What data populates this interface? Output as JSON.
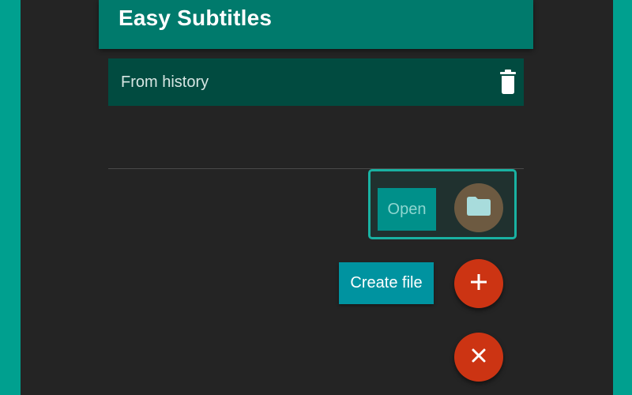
{
  "app": {
    "title": "Easy Subtitles"
  },
  "history": {
    "label": "From history",
    "delete_icon": "trash-icon"
  },
  "speed_dial": {
    "open": {
      "label": "Open",
      "icon": "folder-icon"
    },
    "create": {
      "label": "Create file",
      "icon": "plus-icon"
    },
    "close": {
      "icon": "close-icon"
    }
  },
  "colors": {
    "accent": "#00a08f",
    "app_bar": "#007a6c",
    "fab": "#cc3413",
    "label_chip": "#0093a0"
  }
}
